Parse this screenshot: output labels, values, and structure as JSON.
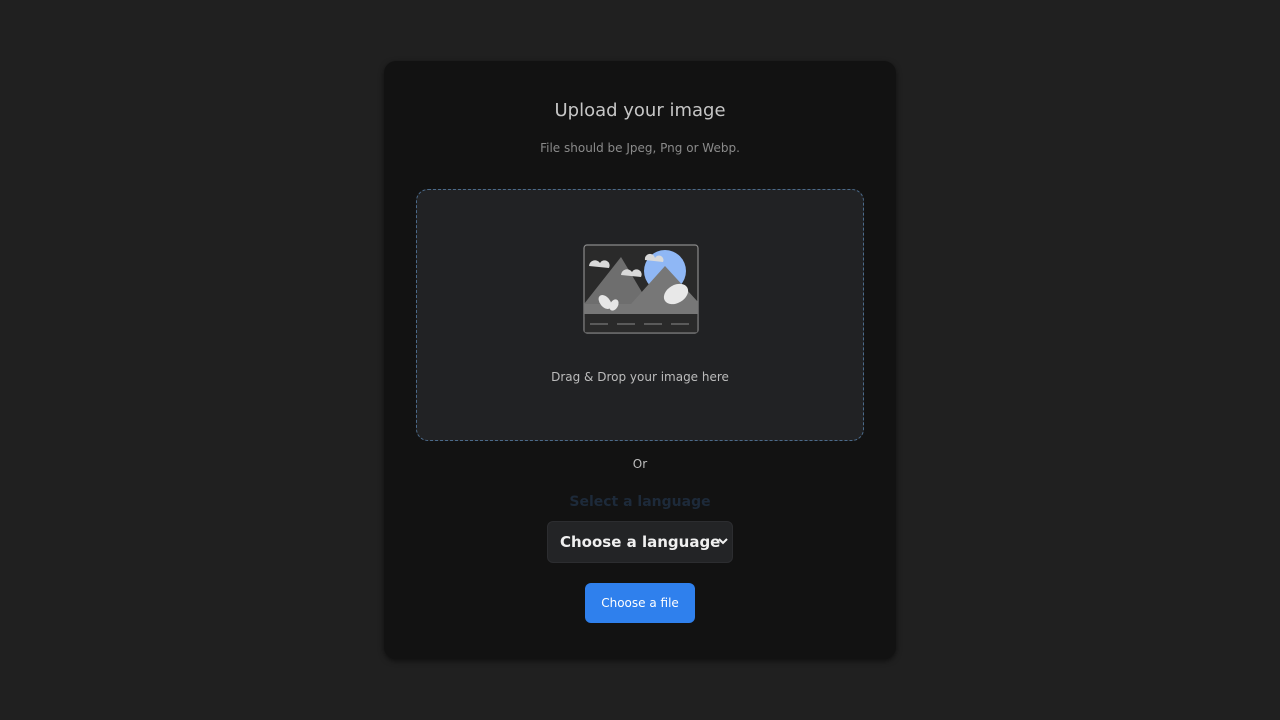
{
  "upload": {
    "title": "Upload your image",
    "subtitle": "File should be Jpeg, Png or Webp.",
    "drop_text": "Drag & Drop your image here",
    "or_text": "Or",
    "language_label": "Select a language",
    "language_select_value": "Choose a language",
    "choose_button_label": "Choose a file",
    "illustration_icon": "image-placeholder-icon"
  },
  "colors": {
    "background": "#202020",
    "card": "#121212",
    "dropzone": "#212224",
    "dropzone_border": "#4b6a8a",
    "accent": "#2f80ed"
  }
}
